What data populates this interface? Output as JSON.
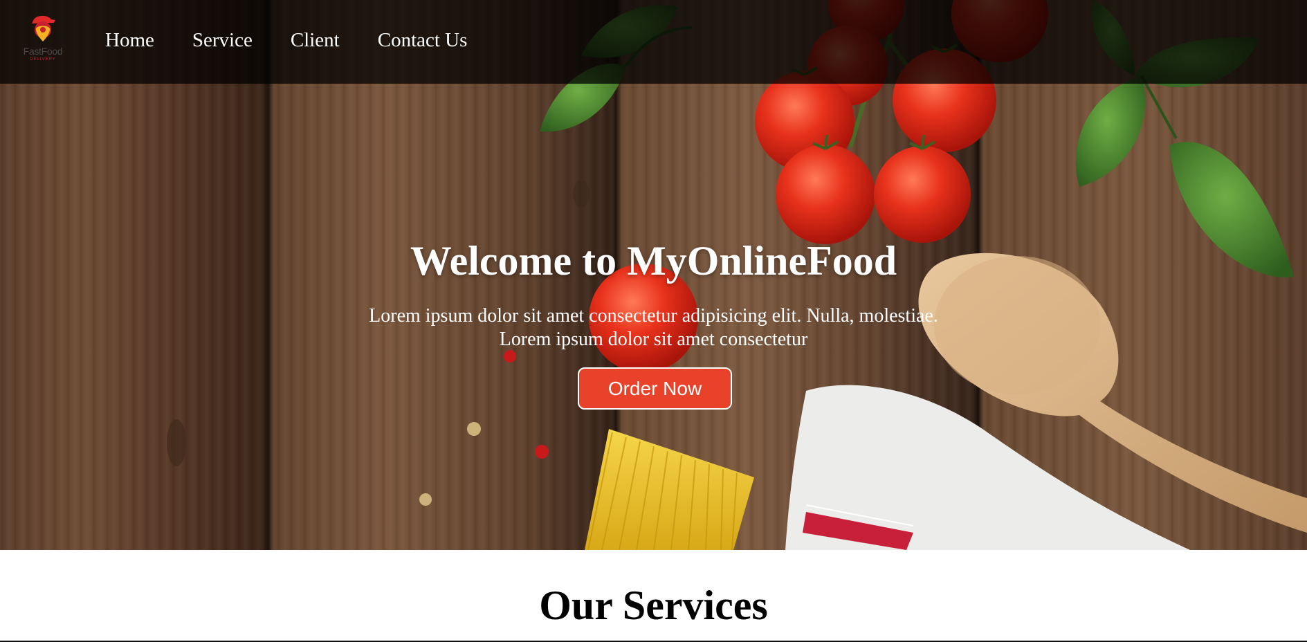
{
  "brand": {
    "logo_text": "FastFood",
    "logo_subtext": "DELIVERY",
    "colors": {
      "primary_red": "#e8432a",
      "logo_red": "#c8202c",
      "logo_yellow": "#f4b223"
    }
  },
  "nav": {
    "items": [
      {
        "label": "Home"
      },
      {
        "label": "Service"
      },
      {
        "label": "Client"
      },
      {
        "label": "Contact Us"
      }
    ]
  },
  "hero": {
    "title": "Welcome to MyOnlineFood",
    "subtitle_line1": "Lorem ipsum dolor sit amet consectetur adipisicing elit. Nulla, molestiae.",
    "subtitle_line2": "Lorem ipsum dolor sit amet consectetur",
    "cta_label": "Order Now",
    "background_icon": "food-table-photo"
  },
  "services": {
    "title": "Our Services"
  }
}
